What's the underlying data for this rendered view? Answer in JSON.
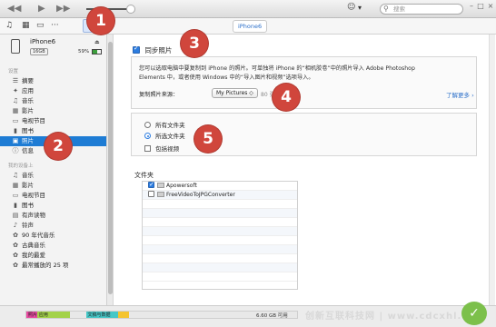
{
  "topbar": {
    "search_placeholder": "搜索",
    "account_icon": "person-icon",
    "apple_logo": "apple-logo"
  },
  "device_tab": "iPhone6",
  "device": {
    "name": "iPhone6",
    "capacity": "16GB",
    "battery_pct": "59%",
    "battery_level": 0.59
  },
  "sidebar": {
    "section_settings": "设置",
    "settings_items": [
      {
        "label": "摘要",
        "icon": "summary-icon"
      },
      {
        "label": "应用",
        "icon": "apps-icon"
      },
      {
        "label": "音乐",
        "icon": "music-icon"
      },
      {
        "label": "影片",
        "icon": "film-icon"
      },
      {
        "label": "电视节目",
        "icon": "tv-icon"
      },
      {
        "label": "图书",
        "icon": "book-icon"
      },
      {
        "label": "照片",
        "icon": "photo-icon",
        "active": true
      },
      {
        "label": "信息",
        "icon": "info-icon"
      }
    ],
    "section_device": "我的设备上",
    "device_items": [
      {
        "label": "音乐",
        "icon": "music-icon"
      },
      {
        "label": "影片",
        "icon": "film-icon"
      },
      {
        "label": "电视节目",
        "icon": "tv-icon"
      },
      {
        "label": "图书",
        "icon": "book-icon"
      },
      {
        "label": "有声读物",
        "icon": "audiobook-icon"
      },
      {
        "label": "铃声",
        "icon": "bell-icon"
      },
      {
        "label": "90 年代音乐",
        "icon": "gear-icon"
      },
      {
        "label": "古典音乐",
        "icon": "gear-icon"
      },
      {
        "label": "我的最爱",
        "icon": "gear-icon"
      },
      {
        "label": "最常播放的 25 项",
        "icon": "gear-icon"
      }
    ]
  },
  "main": {
    "sync_label": "同步照片",
    "description": "您可以选取电脑中要复制到 iPhone 的照片。可单独将 iPhone 的“相机胶卷”中的照片导入 Adobe Photoshop Elements 中，或者使用 Windows 中的“导入图片和视频”选项导入。",
    "copy_from_label": "复制照片来源：",
    "source_value": "My Pictures ◇",
    "photo_count": "80 张照片",
    "learn_more": "了解更多 ›",
    "options": {
      "all_folders": "所有文件夹",
      "selected_folders": "所选文件夹",
      "include_videos": "包括视频"
    },
    "folders_title": "文件夹",
    "folders": [
      {
        "name": "Apowersoft",
        "checked": true
      },
      {
        "name": "FreeVideoToJPGConverter",
        "checked": false
      }
    ]
  },
  "capacity_bar": {
    "segments": [
      {
        "label": "照片",
        "color": "#e74aa0",
        "fraction": 0.04
      },
      {
        "label": "应用",
        "color": "#a3d24a",
        "fraction": 0.12
      },
      {
        "label": "",
        "color": "#e8e8e8",
        "fraction": 0.06
      },
      {
        "label": "文稿与数据",
        "color": "#45c7c7",
        "fraction": 0.12
      },
      {
        "label": "",
        "color": "#f4c430",
        "fraction": 0.04
      }
    ],
    "free_label": "6.60 GB 可用"
  },
  "watermark": "创新互联科技网 | www.cdcxhl.com",
  "markers": [
    "1",
    "2",
    "3",
    "4",
    "5"
  ],
  "colors": {
    "accent_blue": "#1e7cd4",
    "marker_red": "#d0463c",
    "link_blue": "#2b6fc9"
  }
}
